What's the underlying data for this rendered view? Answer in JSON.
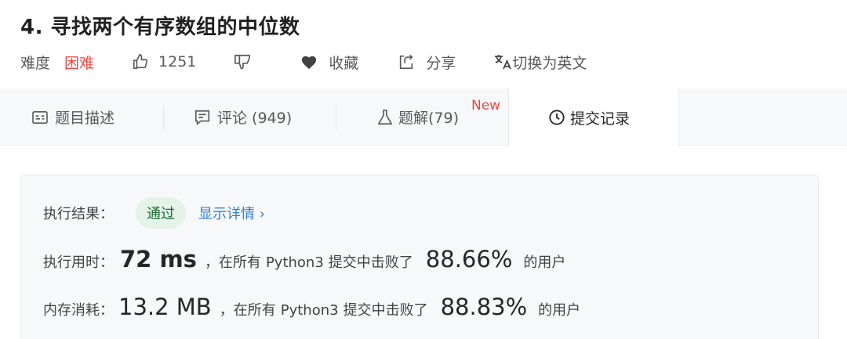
{
  "problem": {
    "title": "4. 寻找两个有序数组的中位数",
    "difficulty_label": "难度",
    "difficulty_value": "困难",
    "likes": "1251",
    "favorite_label": "收藏",
    "share_label": "分享",
    "translate_label": "切换为英文"
  },
  "tabs": [
    {
      "label": "题目描述",
      "icon": "description-icon"
    },
    {
      "label": "评论 (949)",
      "icon": "comment-icon"
    },
    {
      "label": "题解(79)",
      "icon": "flask-icon",
      "badge": "New"
    },
    {
      "label": "提交记录",
      "icon": "clock-icon",
      "active": true
    }
  ],
  "result": {
    "status_label": "执行结果：",
    "status_value": "通过",
    "detail_link": "显示详情 ›",
    "runtime_label": "执行用时：",
    "runtime_value": "72 ms",
    "runtime_prefix": "，在所有",
    "runtime_lang": "Python3",
    "runtime_mid": "提交中击败了",
    "runtime_percent": "88.66%",
    "runtime_suffix": "的用户",
    "memory_label": "内存消耗：",
    "memory_value": "13.2 MB",
    "memory_prefix": "，在所有",
    "memory_lang": "Python3",
    "memory_mid": "提交中击败了",
    "memory_percent": "88.83%",
    "memory_suffix": "的用户"
  },
  "colors": {
    "hard": "#ef4743",
    "pass_bg": "#e3f3e8",
    "pass_text": "#1b6b36",
    "link": "#2e7fd7"
  }
}
